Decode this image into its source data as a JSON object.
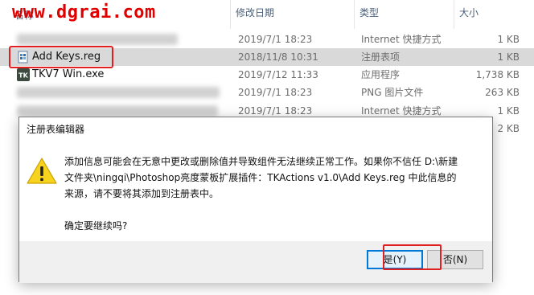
{
  "watermark": "www.dgrai.com",
  "columns": {
    "name": "名称",
    "date": "修改日期",
    "type": "类型",
    "size": "大小"
  },
  "files": [
    {
      "name": "",
      "date": "2019/7/1 18:23",
      "type": "Internet 快捷方式",
      "size": "1 KB",
      "blurred": true,
      "selected": false
    },
    {
      "name": "Add Keys.reg",
      "date": "2018/11/8 10:31",
      "type": "注册表项",
      "size": "1 KB",
      "blurred": false,
      "selected": true
    },
    {
      "name": "TKV7 Win.exe",
      "date": "2019/7/12 11:33",
      "type": "应用程序",
      "size": "1,738 KB",
      "blurred": false,
      "selected": false
    },
    {
      "name": "",
      "date": "2019/7/1 18:23",
      "type": "PNG 图片文件",
      "size": "263 KB",
      "blurred": true,
      "selected": false
    },
    {
      "name": "",
      "date": "2019/7/1 18:23",
      "type": "Internet 快捷方式",
      "size": "1 KB",
      "blurred": true,
      "selected": false
    },
    {
      "name": "",
      "date": "",
      "type": "",
      "size": "2 KB",
      "blurred": true,
      "selected": false
    }
  ],
  "dialog": {
    "title": "注册表编辑器",
    "message_line1": "添加信息可能会在无意中更改或删除值并导致组件无法继续正常工作。如果你不信任 D:\\新建",
    "message_line2": "文件夹\\ningqi\\Photoshop亮度蒙板扩展插件：TKActions v1.0\\Add Keys.reg 中此信息的",
    "message_line3": "来源，请不要将其添加到注册表中。",
    "confirm": "确定要继续吗?",
    "yes_label": "是(Y)",
    "no_label": "否(N)"
  },
  "colors": {
    "highlight": "#e02020",
    "watermark": "#e00000",
    "focus": "#0078d7"
  }
}
